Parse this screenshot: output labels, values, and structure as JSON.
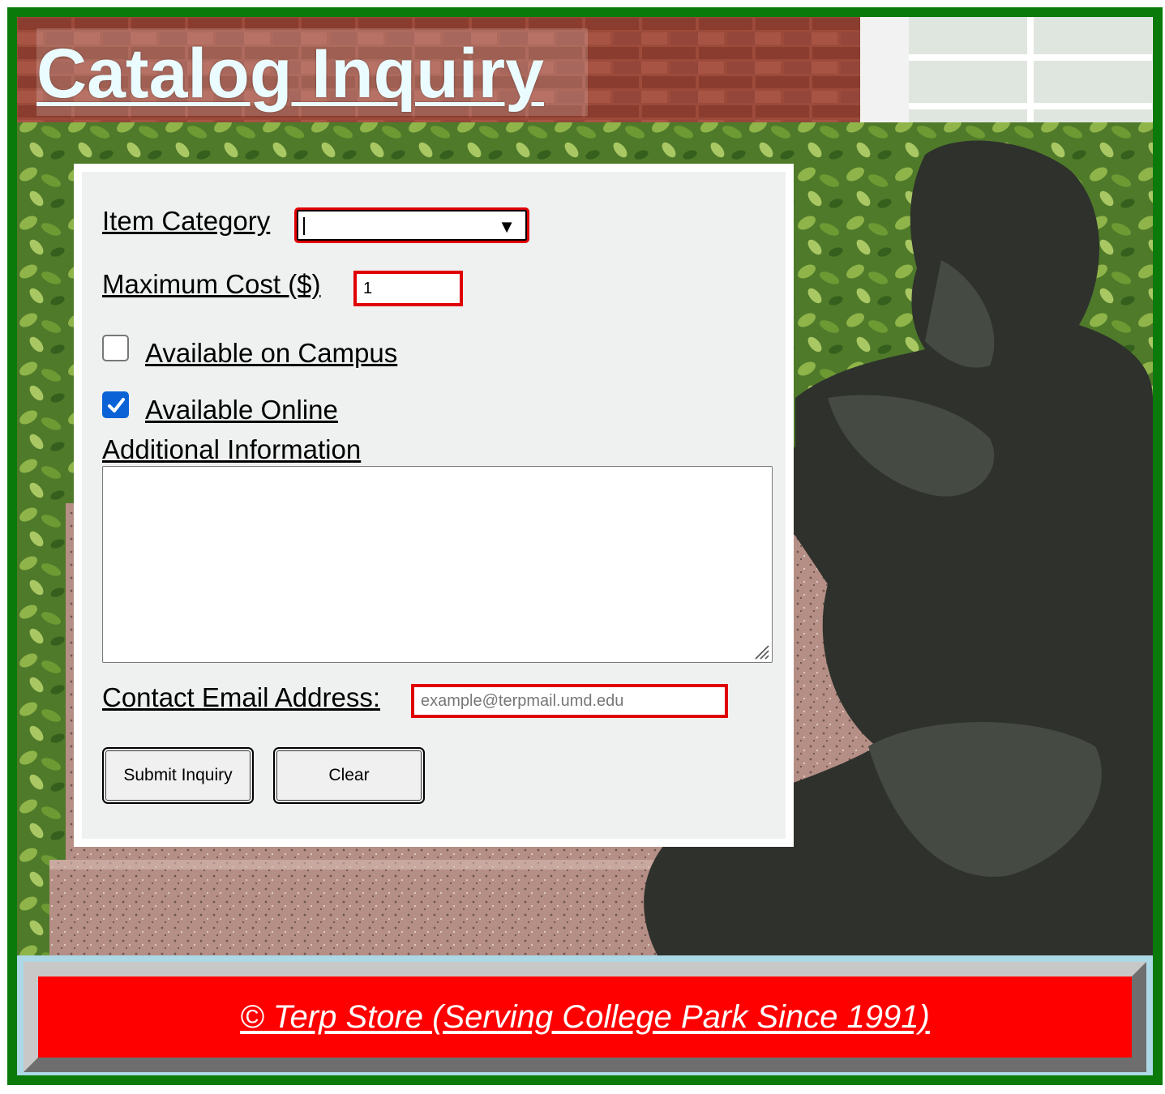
{
  "header": {
    "title": "Catalog Inquiry"
  },
  "form": {
    "item_category": {
      "label": "Item Category",
      "value": ""
    },
    "max_cost": {
      "label": "Maximum Cost ($)",
      "value": "1"
    },
    "available_campus": {
      "label": "Available on Campus",
      "checked": false
    },
    "available_online": {
      "label": "Available Online",
      "checked": true
    },
    "additional_info": {
      "label": "Additional Information",
      "value": ""
    },
    "email": {
      "label": "Contact Email Address:",
      "placeholder": "example@terpmail.umd.edu",
      "value": ""
    },
    "submit_label": "Submit Inquiry",
    "clear_label": "Clear"
  },
  "footer": {
    "text": "© Terp Store (Serving College Park Since 1991)"
  },
  "colors": {
    "frame": "#0a7a0a",
    "field_border": "#e00000",
    "footer_bg": "#ff0000",
    "footer_outer": "#add8e6",
    "checkbox_checked": "#0b62d6"
  },
  "icons": {
    "dropdown": "triangle-down-icon",
    "checkmark": "checkmark-icon",
    "resize": "resize-grip-icon"
  }
}
